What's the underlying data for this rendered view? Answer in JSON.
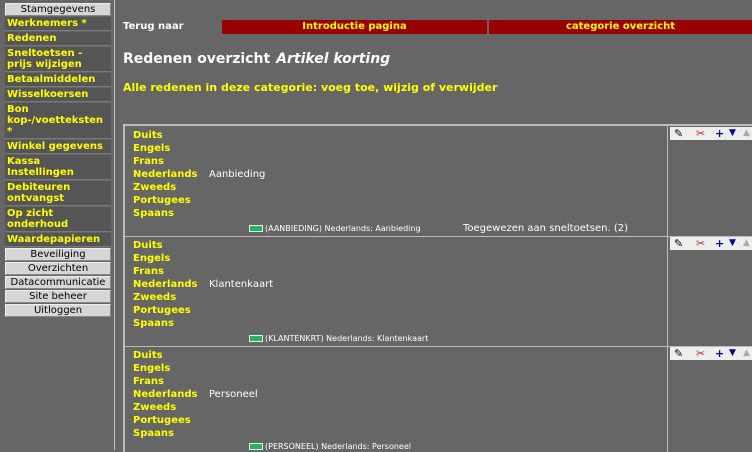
{
  "sidebar": {
    "top_button": "Stamgegevens",
    "links": [
      "Werknemers *",
      "Redenen",
      "Sneltoetsen - prijs wijzigen",
      "Betaalmiddelen",
      "Wisselkoersen",
      "Bon kop-/voetteksten *",
      "Winkel gegevens",
      "Kassa Instellingen",
      "Debiteuren ontvangst",
      "Op zicht onderhoud",
      "Waardepapieren"
    ],
    "buttons": [
      "Beveiliging",
      "Overzichten",
      "Datacommunicatie",
      "Site beheer",
      "Uitloggen"
    ]
  },
  "topbar": {
    "back_label": "Terug naar",
    "tab1": "Introductie pagina",
    "tab2": "categorie overzicht"
  },
  "page": {
    "title": "Redenen overzicht",
    "category": "Artikel korting",
    "subtitle": "Alle redenen in deze categorie: voeg toe, wijzig of verwijder"
  },
  "languages": [
    "Duits",
    "Engels",
    "Frans",
    "Nederlands",
    "Zweeds",
    "Portugees",
    "Spaans"
  ],
  "reasons": [
    {
      "name": "Aanbieding",
      "code_line": "(AANBIEDING) Nederlands: Aanbieding",
      "assigned": "Toegewezen aan sneltoetsen. (2)"
    },
    {
      "name": "Klantenkaart",
      "code_line": "(KLANTENKRT) Nederlands: Klantenkaart",
      "assigned": ""
    },
    {
      "name": "Personeel",
      "code_line": "(PERSONEEL) Nederlands: Personeel",
      "assigned": ""
    }
  ],
  "icons": {
    "edit": "edit-pencil-icon",
    "delete": "scissors-icon",
    "add": "plus-icon",
    "down": "arrow-down-icon",
    "up": "arrow-up-icon",
    "keyboard": "keyboard-icon"
  },
  "colors": {
    "accent_red": "#990000",
    "link_yellow": "#ffff00",
    "background": "#666666"
  }
}
